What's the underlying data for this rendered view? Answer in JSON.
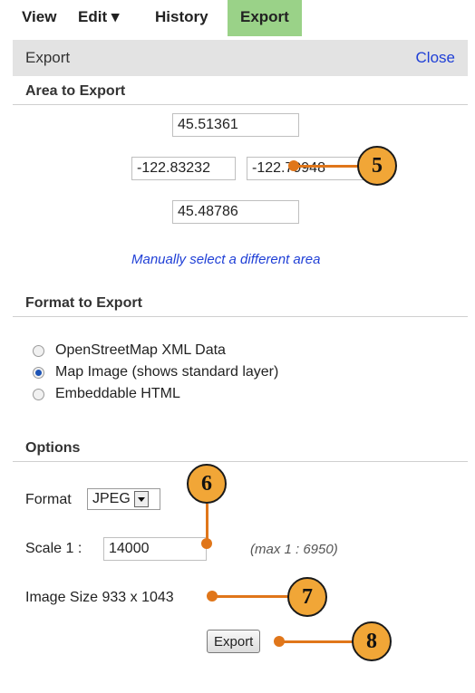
{
  "tabs": [
    {
      "label": "View"
    },
    {
      "label": "Edit ▾"
    },
    {
      "label": "History"
    },
    {
      "label": "Export"
    }
  ],
  "panel": {
    "title": "Export",
    "close_label": "Close"
  },
  "area": {
    "section_title": "Area to Export",
    "north": "45.51361",
    "west": "-122.83232",
    "east": "-122.79948",
    "south": "45.48786",
    "manual_link": "Manually select a different area"
  },
  "format_section": {
    "section_title": "Format to Export",
    "options": [
      {
        "label": "OpenStreetMap XML Data",
        "checked": false
      },
      {
        "label": "Map Image (shows standard layer)",
        "checked": true
      },
      {
        "label": "Embeddable HTML",
        "checked": false
      }
    ]
  },
  "options": {
    "section_title": "Options",
    "format_label": "Format",
    "format_value": "JPEG",
    "scale_label": "Scale 1 :",
    "scale_value": "14000",
    "scale_max": "(max 1 : 6950)",
    "image_size_text": "Image Size 933 x 1043"
  },
  "export_button": "Export",
  "callouts": [
    "5",
    "6",
    "7",
    "8"
  ],
  "colors": {
    "active_tab": "#9ad288",
    "callout_fill": "#f1a637",
    "callout_line": "#e0761a",
    "link": "#1f3fd6"
  }
}
